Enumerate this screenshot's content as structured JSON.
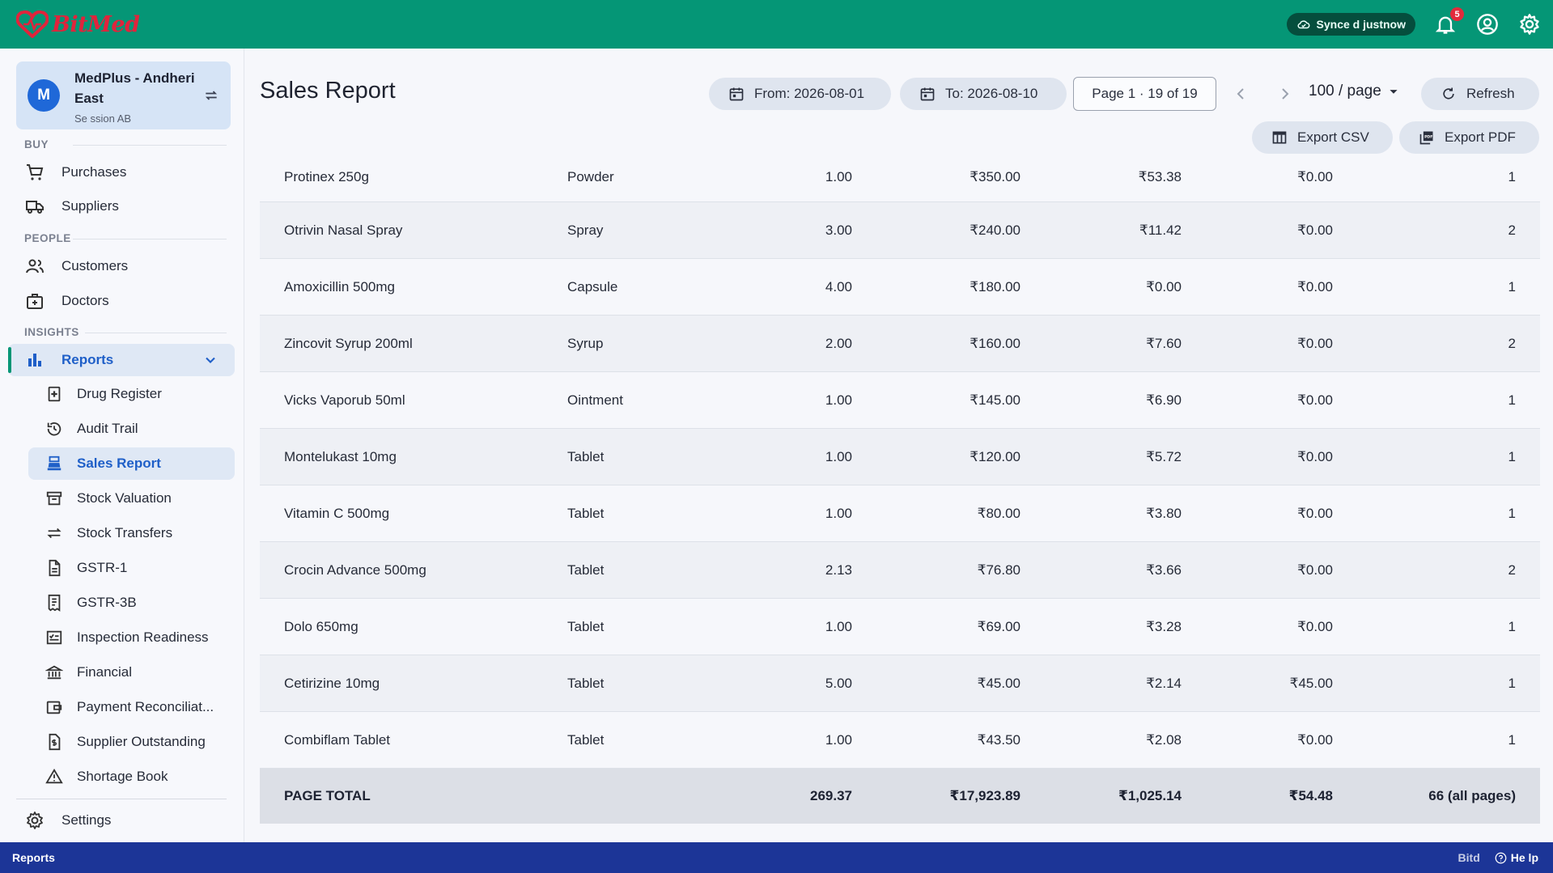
{
  "app": {
    "name": "BitMed"
  },
  "topbar": {
    "sync_status": "Synce d justnow",
    "notification_count": "5"
  },
  "sidebar": {
    "store": {
      "initial": "M",
      "name": "MedPlus - Andheri East",
      "session": "Se ssion AB"
    },
    "sections": {
      "buy": "BUY",
      "people": "PEOPLE",
      "insights": "INSIGHTS"
    },
    "buy_items": [
      {
        "label": "Purchases"
      },
      {
        "label": "Suppliers"
      }
    ],
    "people_items": [
      {
        "label": "Customers"
      },
      {
        "label": "Doctors"
      }
    ],
    "reports_label": "Reports",
    "report_items": [
      {
        "label": "Drug Register"
      },
      {
        "label": "Audit Trail"
      },
      {
        "label": "Sales Report"
      },
      {
        "label": "Stock Valuation"
      },
      {
        "label": "Stock Transfers"
      },
      {
        "label": "GSTR-1"
      },
      {
        "label": "GSTR-3B"
      },
      {
        "label": "Inspection Readiness"
      },
      {
        "label": "Financial"
      },
      {
        "label": "Payment Reconciliat..."
      },
      {
        "label": "Supplier Outstanding"
      },
      {
        "label": "Shortage Book"
      }
    ],
    "settings_label": "Settings"
  },
  "main": {
    "title": "Sales Report",
    "from_label": "From: 2026-08-01",
    "to_label": "To: 2026-08-10",
    "page_info": "Page 1 · 19 of 19",
    "per_page": "100 / page",
    "refresh_label": "Refresh",
    "export_csv_label": "Export CSV",
    "export_pdf_label": "Export PDF"
  },
  "table": {
    "rows": [
      {
        "name": "Protinex 250g",
        "form": "Powder",
        "qty": "1.00",
        "amount": "₹350.00",
        "gst": "₹53.38",
        "discount": "₹0.00",
        "bills": "1"
      },
      {
        "name": "Otrivin Nasal Spray",
        "form": "Spray",
        "qty": "3.00",
        "amount": "₹240.00",
        "gst": "₹11.42",
        "discount": "₹0.00",
        "bills": "2"
      },
      {
        "name": "Amoxicillin 500mg",
        "form": "Capsule",
        "qty": "4.00",
        "amount": "₹180.00",
        "gst": "₹0.00",
        "discount": "₹0.00",
        "bills": "1"
      },
      {
        "name": "Zincovit Syrup 200ml",
        "form": "Syrup",
        "qty": "2.00",
        "amount": "₹160.00",
        "gst": "₹7.60",
        "discount": "₹0.00",
        "bills": "2"
      },
      {
        "name": "Vicks Vaporub 50ml",
        "form": "Ointment",
        "qty": "1.00",
        "amount": "₹145.00",
        "gst": "₹6.90",
        "discount": "₹0.00",
        "bills": "1"
      },
      {
        "name": "Montelukast 10mg",
        "form": "Tablet",
        "qty": "1.00",
        "amount": "₹120.00",
        "gst": "₹5.72",
        "discount": "₹0.00",
        "bills": "1"
      },
      {
        "name": "Vitamin C 500mg",
        "form": "Tablet",
        "qty": "1.00",
        "amount": "₹80.00",
        "gst": "₹3.80",
        "discount": "₹0.00",
        "bills": "1"
      },
      {
        "name": "Crocin Advance 500mg",
        "form": "Tablet",
        "qty": "2.13",
        "amount": "₹76.80",
        "gst": "₹3.66",
        "discount": "₹0.00",
        "bills": "2"
      },
      {
        "name": "Dolo 650mg",
        "form": "Tablet",
        "qty": "1.00",
        "amount": "₹69.00",
        "gst": "₹3.28",
        "discount": "₹0.00",
        "bills": "1"
      },
      {
        "name": "Cetirizine 10mg",
        "form": "Tablet",
        "qty": "5.00",
        "amount": "₹45.00",
        "gst": "₹2.14",
        "discount": "₹45.00",
        "bills": "1"
      },
      {
        "name": "Combiflam Tablet",
        "form": "Tablet",
        "qty": "1.00",
        "amount": "₹43.50",
        "gst": "₹2.08",
        "discount": "₹0.00",
        "bills": "1"
      }
    ],
    "total": {
      "label": "PAGE TOTAL",
      "qty": "269.37",
      "amount": "₹17,923.89",
      "gst": "₹1,025.14",
      "discount": "₹54.48",
      "bills": "66 (all pages)"
    }
  },
  "statusbar": {
    "left": "Reports",
    "right_a": "Bitd",
    "help": "He lp"
  },
  "colors": {
    "topbar": "#059676",
    "statusbar": "#1c3597",
    "accent": "#1f5fc8",
    "brand": "#e0243c"
  }
}
